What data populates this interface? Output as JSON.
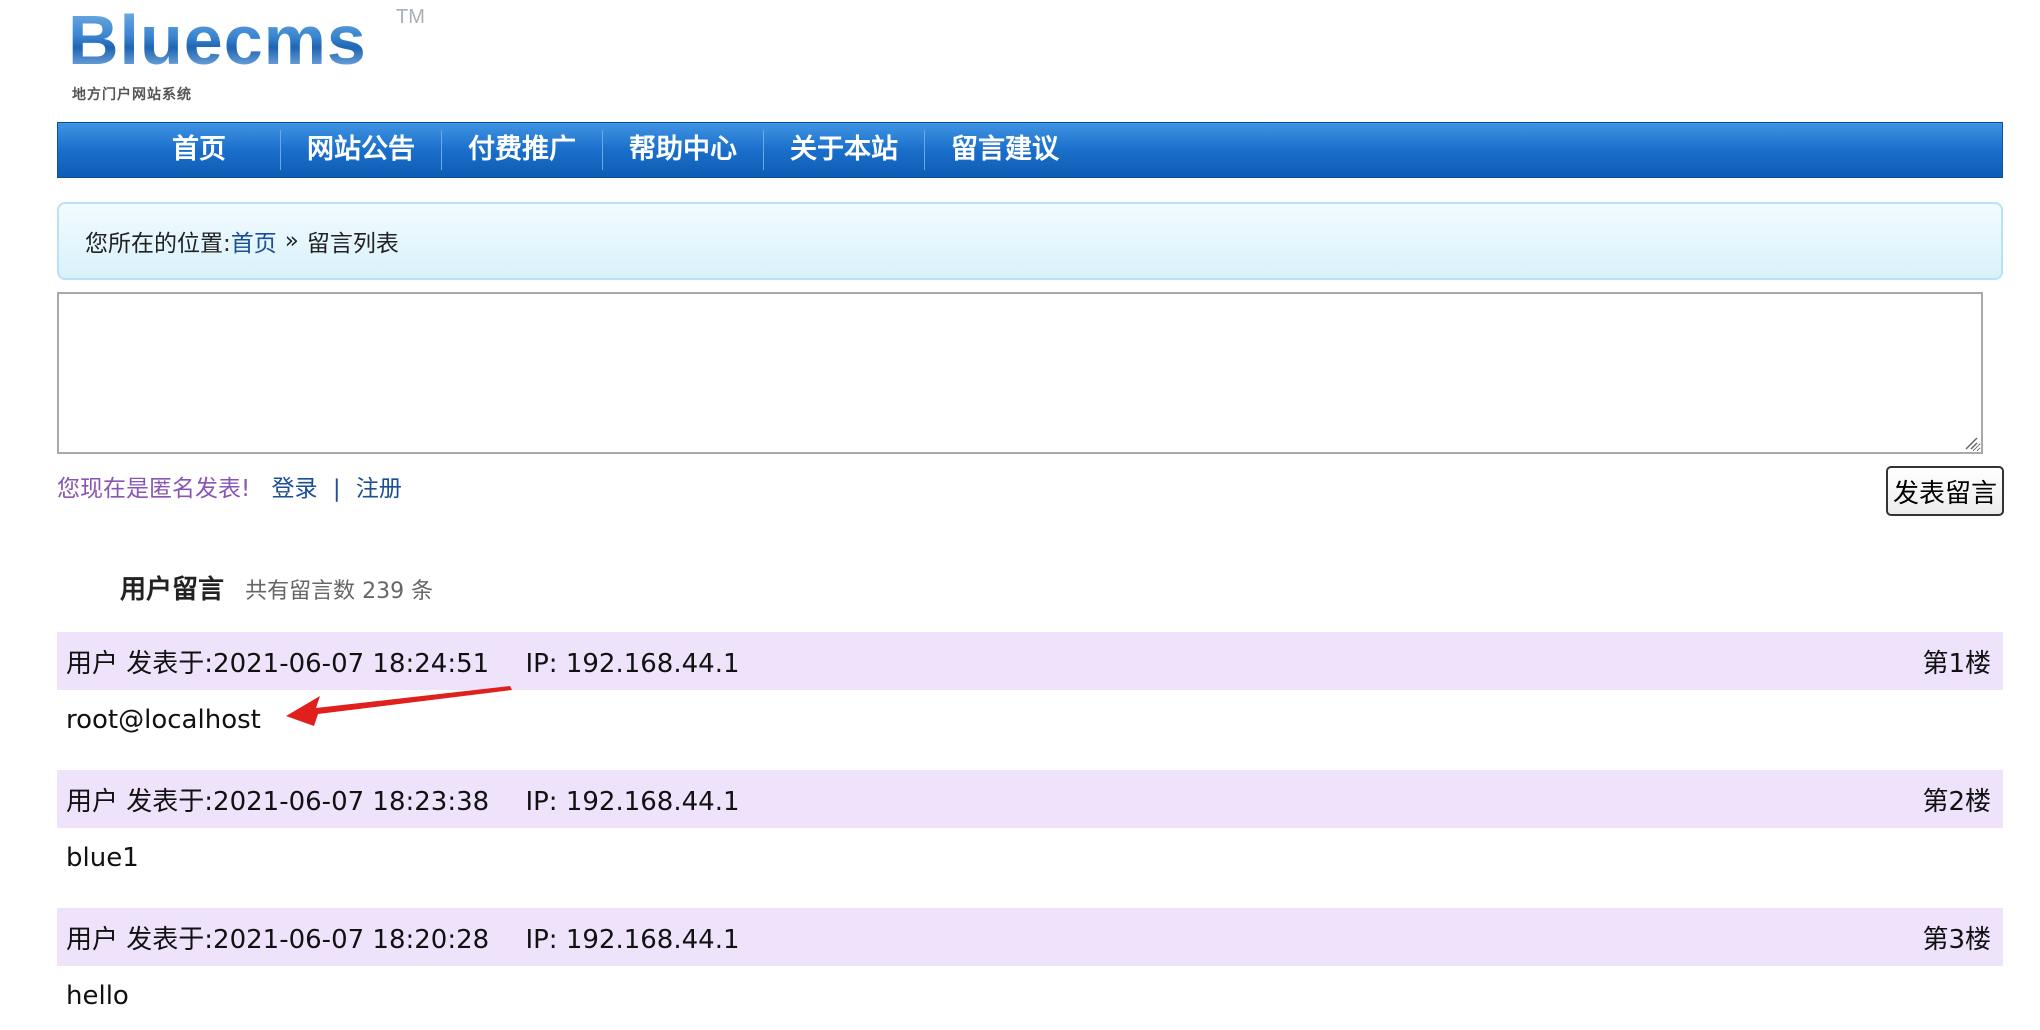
{
  "logo": {
    "word": "Bluecms",
    "tm": "TM",
    "subtitle": "地方门户网站系统"
  },
  "nav": {
    "items": [
      "首页",
      "网站公告",
      "付费推广",
      "帮助中心",
      "关于本站",
      "留言建议"
    ]
  },
  "breadcrumb": {
    "prefix": "您所在的位置:",
    "home": "首页",
    "separator": "»",
    "current": "留言列表"
  },
  "form": {
    "textarea_value": "",
    "anon_text": "您现在是匿名发表!",
    "login": "登录",
    "divider": "|",
    "register": "注册",
    "submit_label": "发表留言"
  },
  "messages_section": {
    "title": "用户留言",
    "count_text": "共有留言数 239 条"
  },
  "messages": [
    {
      "author": "用户",
      "posted_label": "发表于:",
      "timestamp": "2021-06-07 18:24:51",
      "ip": "IP: 192.168.44.1",
      "floor": "第1楼",
      "body": "root@localhost"
    },
    {
      "author": "用户",
      "posted_label": "发表于:",
      "timestamp": "2021-06-07 18:23:38",
      "ip": "IP: 192.168.44.1",
      "floor": "第2楼",
      "body": "blue1"
    },
    {
      "author": "用户",
      "posted_label": "发表于:",
      "timestamp": "2021-06-07 18:20:28",
      "ip": "IP: 192.168.44.1",
      "floor": "第3楼",
      "body": "hello"
    }
  ],
  "colors": {
    "nav_blue": "#1a6fca",
    "link_blue": "#1a4e96",
    "anon_purple": "#8a55b5",
    "row_bg": "#efe3fb",
    "annotation_red": "#e0201c"
  }
}
